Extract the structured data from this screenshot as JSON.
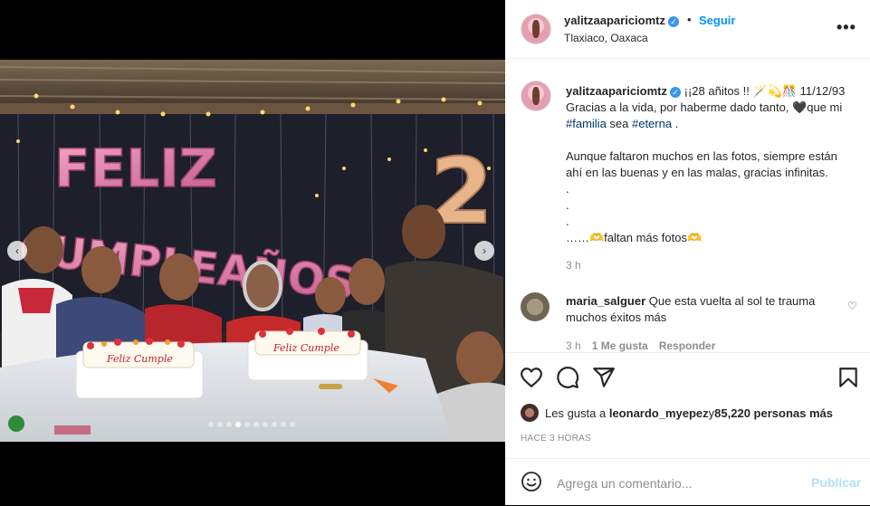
{
  "post": {
    "username": "yalitzaapariciomtz",
    "separator": "•",
    "follow_label": "Seguir",
    "location": "Tlaxiaco, Oaxaca",
    "more_label": "•••"
  },
  "photo": {
    "balloon_text_1": "FELIZ",
    "balloon_text_2": "CUMPLEAÑOS",
    "balloon_number": "2",
    "cake_text": "Feliz Cumple"
  },
  "carousel": {
    "prev_icon": "‹",
    "next_icon": "›",
    "slide_count": 10,
    "active_index": 3
  },
  "caption": {
    "username": "yalitzaapariciomtz",
    "line1": "¡¡28 añitos !! 🪄💫🎊 11/12/93",
    "line2": "Gracias a la vida, por haberme dado tanto, 🖤que mi",
    "tag1": "#familia",
    "mid": " sea ",
    "tag2": "#eterna",
    "end": " .",
    "para2": "Aunque faltaron muchos en las fotos, siempre están ahí en las buenas y en las malas, gracias infinitas.",
    "dot": ".",
    "last": "……🫶faltan más fotos🫶",
    "time": "3 h"
  },
  "comment": {
    "username": "maria_salguer",
    "text": "Que esta vuelta al sol te trauma muchos éxitos más",
    "time": "3 h",
    "likes": "1 Me gusta",
    "reply": "Responder"
  },
  "likes": {
    "prefix": "Les gusta a ",
    "user": "leonardo_myepez",
    "middle": " y ",
    "count": "85,220 personas más"
  },
  "ago": "HACE 3 HORAS",
  "add_comment": {
    "emoji_icon": "smiley-icon",
    "placeholder": "Agrega un comentario...",
    "publish": "Publicar"
  },
  "colors": {
    "accent": "#0095f6",
    "verified": "#3897f0",
    "publish_disabled": "#b2dffc",
    "hashtag": "#00376b"
  }
}
